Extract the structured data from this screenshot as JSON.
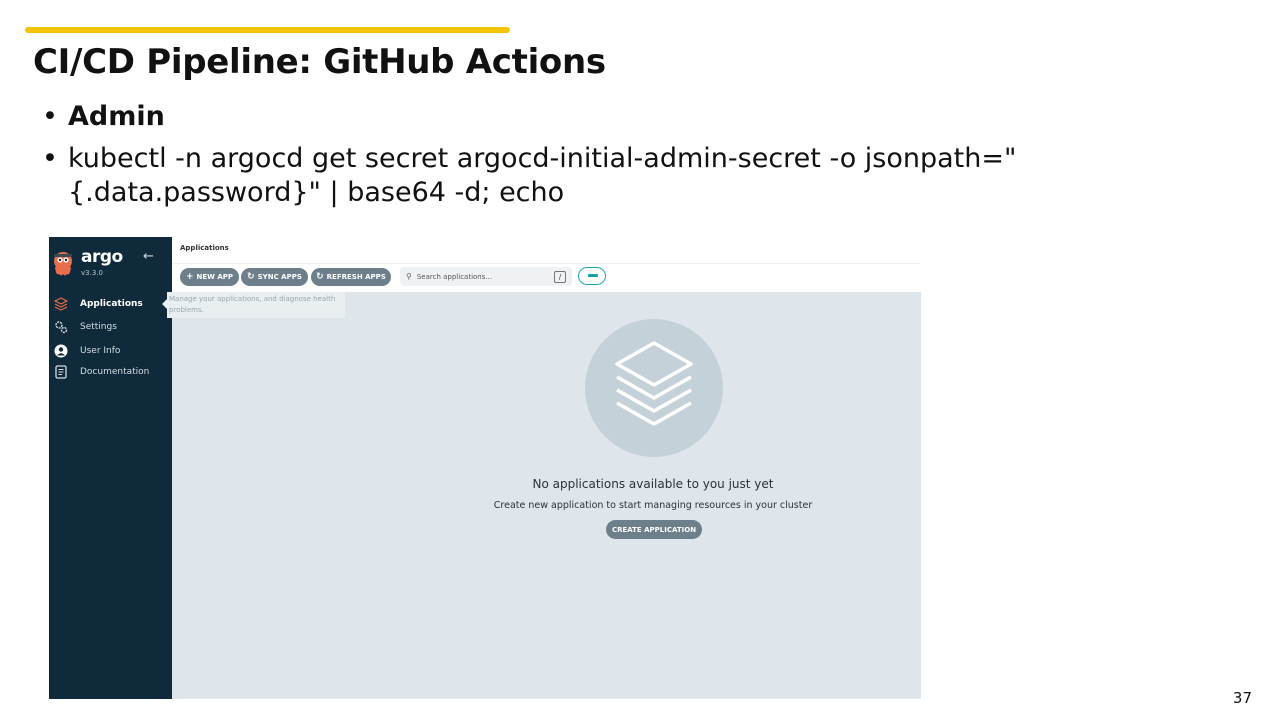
{
  "slide": {
    "title": "CI/CD Pipeline: GitHub Actions",
    "bullets": [
      "Admin",
      "kubectl -n argocd get secret argocd-initial-admin-secret -o jsonpath=\"{.data.password}\" | base64 -d; echo"
    ],
    "page_number": "37",
    "accent_color": "#f5c400"
  },
  "app": {
    "brand": "argo",
    "version": "v3.3.0",
    "nav": [
      {
        "label": "Applications",
        "icon": "layers-icon",
        "active": true
      },
      {
        "label": "Settings",
        "icon": "gears-icon",
        "active": false
      },
      {
        "label": "User Info",
        "icon": "user-icon",
        "active": false
      },
      {
        "label": "Documentation",
        "icon": "docs-icon",
        "active": false
      }
    ],
    "tooltip": "Manage your applications, and diagnose health problems.",
    "breadcrumb": "Applications",
    "toolbar": {
      "new_app": "NEW APP",
      "sync_apps": "SYNC APPS",
      "refresh_apps": "REFRESH APPS",
      "search_placeholder": "Search applications...",
      "search_shortcut": "/"
    },
    "empty": {
      "title": "No applications available to you just yet",
      "subtitle": "Create new application to start managing resources in your cluster",
      "create_button": "CREATE APPLICATION"
    },
    "colors": {
      "sidebar": "#0f2a3a",
      "button": "#6d7f8b",
      "toggle": "#21a8b5",
      "background": "#dee6eb"
    }
  }
}
